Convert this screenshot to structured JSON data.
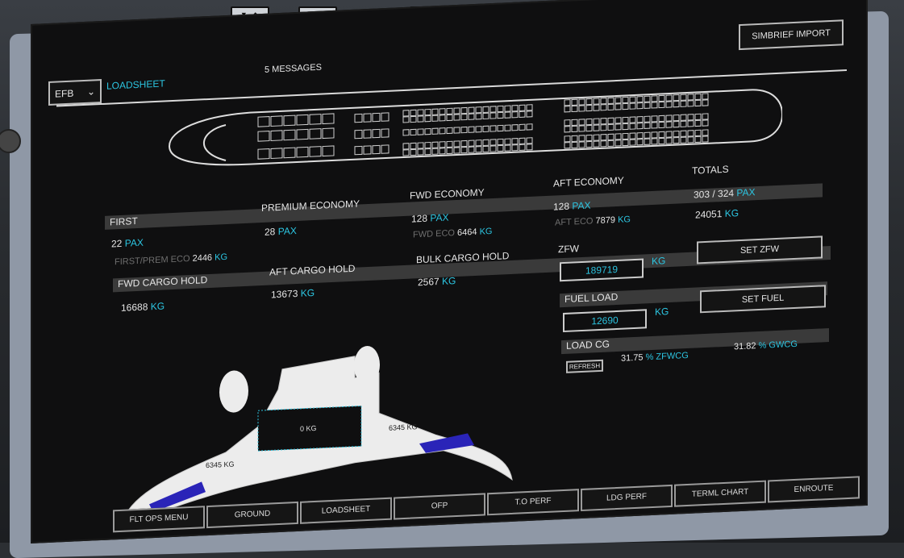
{
  "header": {
    "efb_label": "EFB",
    "page_title": "LOADSHEET",
    "messages": "5 MESSAGES",
    "simbrief_button": "SIMBRIEF IMPORT"
  },
  "cabin": {
    "first": {
      "title": "FIRST",
      "pax": "22",
      "pax_unit": "PAX",
      "sub_label": "FIRST/PREM ECO",
      "sub_value": "2446",
      "sub_unit": "KG"
    },
    "premium": {
      "title": "PREMIUM ECONOMY",
      "pax": "28",
      "pax_unit": "PAX"
    },
    "fwd_eco": {
      "title": "FWD ECONOMY",
      "pax": "128",
      "pax_unit": "PAX",
      "sub_label": "FWD ECO",
      "sub_value": "6464",
      "sub_unit": "KG"
    },
    "aft_eco": {
      "title": "AFT ECONOMY",
      "pax": "128",
      "pax_unit": "PAX",
      "sub_label": "AFT ECO",
      "sub_value": "7879",
      "sub_unit": "KG"
    },
    "totals": {
      "title": "TOTALS",
      "pax": "303 / 324",
      "pax_unit": "PAX",
      "weight": "24051",
      "weight_unit": "KG"
    }
  },
  "cargo": {
    "fwd": {
      "title": "FWD CARGO HOLD",
      "value": "16688",
      "unit": "KG"
    },
    "aft": {
      "title": "AFT CARGO HOLD",
      "value": "13673",
      "unit": "KG"
    },
    "bulk": {
      "title": "BULK CARGO HOLD",
      "value": "2567",
      "unit": "KG"
    }
  },
  "zfw": {
    "title": "ZFW",
    "value": "189719",
    "unit": "KG",
    "button": "SET ZFW"
  },
  "fuel": {
    "title": "FUEL LOAD",
    "value": "12690",
    "unit": "KG",
    "button": "SET FUEL"
  },
  "cg": {
    "title": "LOAD CG",
    "refresh": "REFRESH",
    "zfwcg_value": "31.75",
    "zfwcg_unit": "% ZFWCG",
    "gwcg_value": "31.82",
    "gwcg_unit": "% GWCG"
  },
  "wing": {
    "left_tank": "6345 KG",
    "center_tank": "0 KG",
    "right_tank": "6345 KG"
  },
  "tabs": [
    "FLT OPS MENU",
    "GROUND",
    "LOADSHEET",
    "OFP",
    "T.O PERF",
    "LDG PERF",
    "TERML CHART",
    "ENROUTE"
  ],
  "bezel_buttons": [
    "▼ ◆",
    "◆ ▲",
    "▼ ◐",
    "◐ ▲"
  ],
  "colors": {
    "accent": "#2cc4e0",
    "fuel_fill": "#2222aa",
    "panel_bar": "#3a3a3a"
  }
}
